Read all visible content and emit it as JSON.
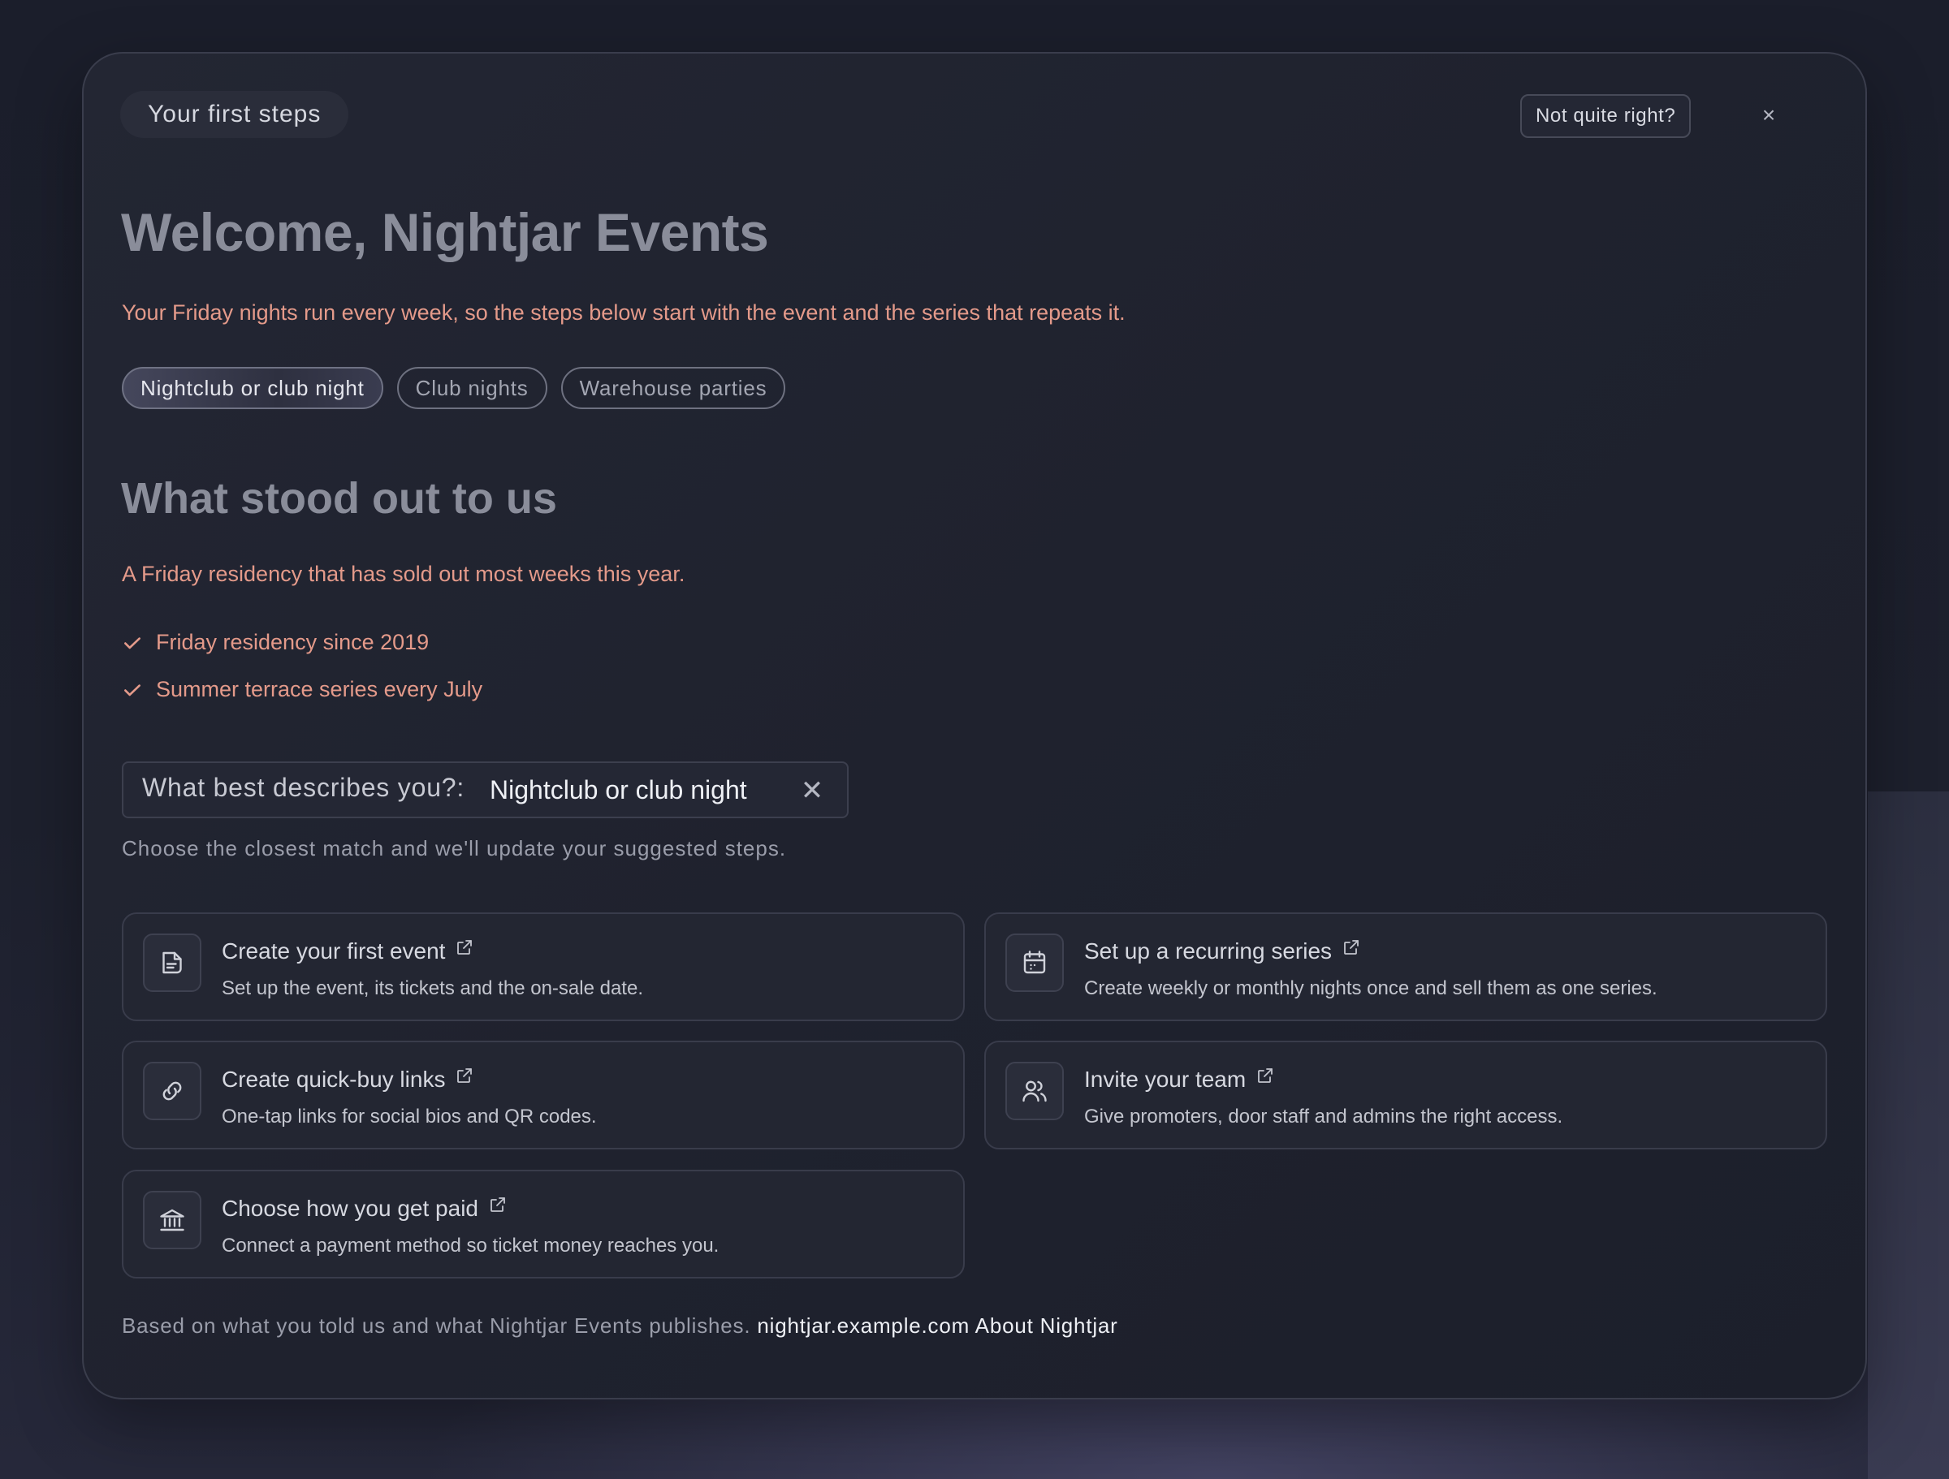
{
  "header": {
    "steps_pill": "Your first steps",
    "not_quite_right": "Not quite right?",
    "close_label": "×"
  },
  "welcome": {
    "title": "Welcome, Nightjar Events",
    "intro": "Your Friday nights run every week, so the steps below start with the event and the series that repeats it."
  },
  "tags": [
    {
      "label": "Nightclub or club night",
      "active": true
    },
    {
      "label": "Club nights",
      "active": false
    },
    {
      "label": "Warehouse parties",
      "active": false
    }
  ],
  "stood_out": {
    "title": "What stood out to us",
    "summary": "A Friday residency that has sold out most weeks this year.",
    "highlights": [
      "Friday residency since 2019",
      "Summer terrace series every July"
    ]
  },
  "describe": {
    "label": "What best describes you?:",
    "value": "Nightclub or club night",
    "clear_label": "✕",
    "help": "Choose the closest match and we'll update your suggested steps."
  },
  "tasks": [
    {
      "title": "Create your first event",
      "desc": "Set up the event, its tickets and the on-sale date.",
      "icon": "document-icon"
    },
    {
      "title": "Set up a recurring series",
      "desc": "Create weekly or monthly nights once and sell them as one series.",
      "icon": "calendar-icon"
    },
    {
      "title": "Create quick-buy links",
      "desc": "One-tap links for social bios and QR codes.",
      "icon": "link-icon"
    },
    {
      "title": "Invite your team",
      "desc": "Give promoters, door staff and admins the right access.",
      "icon": "users-icon"
    },
    {
      "title": "Choose how you get paid",
      "desc": "Connect a payment method so ticket money reaches you.",
      "icon": "bank-icon"
    }
  ],
  "footer": {
    "text": "Based on what you told us and what Nightjar Events publishes.",
    "link_site": "nightjar.example.com",
    "link_about": "About Nightjar"
  },
  "colors": {
    "accent_salmon": "#e49a8a",
    "background": "#1d202d",
    "card": "#232632"
  }
}
